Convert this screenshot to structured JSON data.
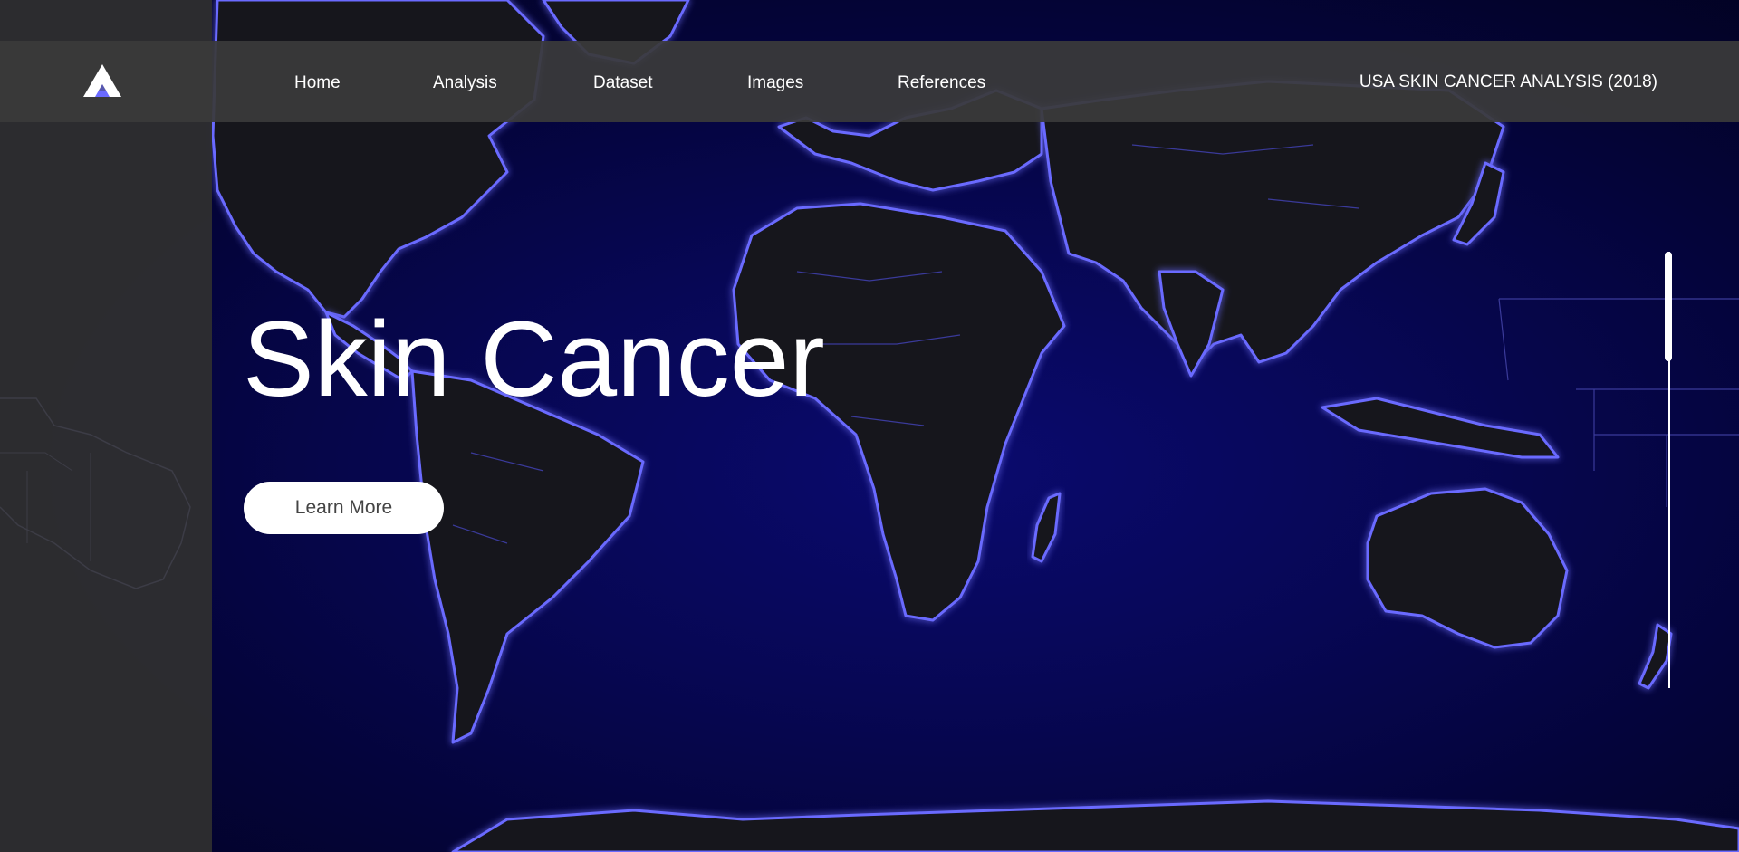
{
  "nav": {
    "logo_icon": "triangle-mountain-logo-icon",
    "links": [
      "Home",
      "Analysis",
      "Dataset",
      "Images",
      "References"
    ],
    "brand_title": "USA SKIN CANCER ANALYSIS (2018)"
  },
  "hero": {
    "title": "Skin Cancer",
    "cta_label": "Learn More"
  },
  "scroll_indicator": {
    "position_fraction": 0.0,
    "visible_fraction": 0.25
  },
  "colors": {
    "ocean": "#07075a",
    "coastline_glow": "#6a6aff",
    "navbar": "#3a3a3a",
    "side_panel": "#2d2d30",
    "text": "#ffffff"
  }
}
